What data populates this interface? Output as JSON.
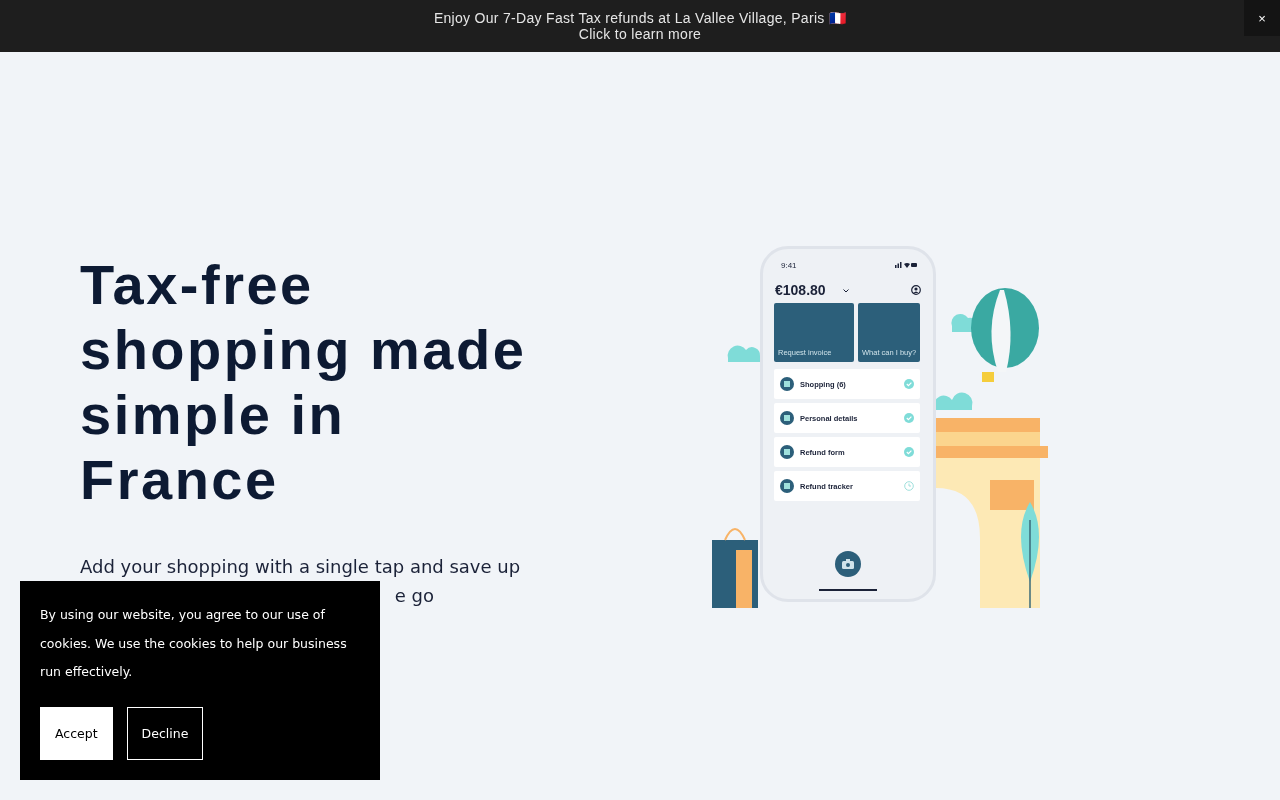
{
  "announcement": {
    "line1": "Enjoy Our 7-Day Fast Tax refunds at La Vallee Village, Paris 🇫🇷",
    "line2": "Click to learn more",
    "close": "×"
  },
  "hero": {
    "title": "Tax-free shopping made simple in France",
    "subtitle": "Add your shopping with a single tap and save up",
    "subtitle_tail": "e go"
  },
  "phone": {
    "time": "9:41",
    "amount": "€108.80",
    "tiles": [
      {
        "label": "Request invoice"
      },
      {
        "label": "What can I buy?"
      }
    ],
    "rows": [
      {
        "label": "Shopping (6)",
        "done": true
      },
      {
        "label": "Personal details",
        "done": true
      },
      {
        "label": "Refund form",
        "done": true
      },
      {
        "label": "Refund tracker",
        "done": false
      }
    ]
  },
  "cookie": {
    "text": "By using our website, you agree to our use of cookies. We use the cookies to help our business run effectively.",
    "buttons": [
      {
        "label": "Accept",
        "kind": "primary"
      },
      {
        "label": "Decline",
        "kind": "outline"
      }
    ]
  }
}
